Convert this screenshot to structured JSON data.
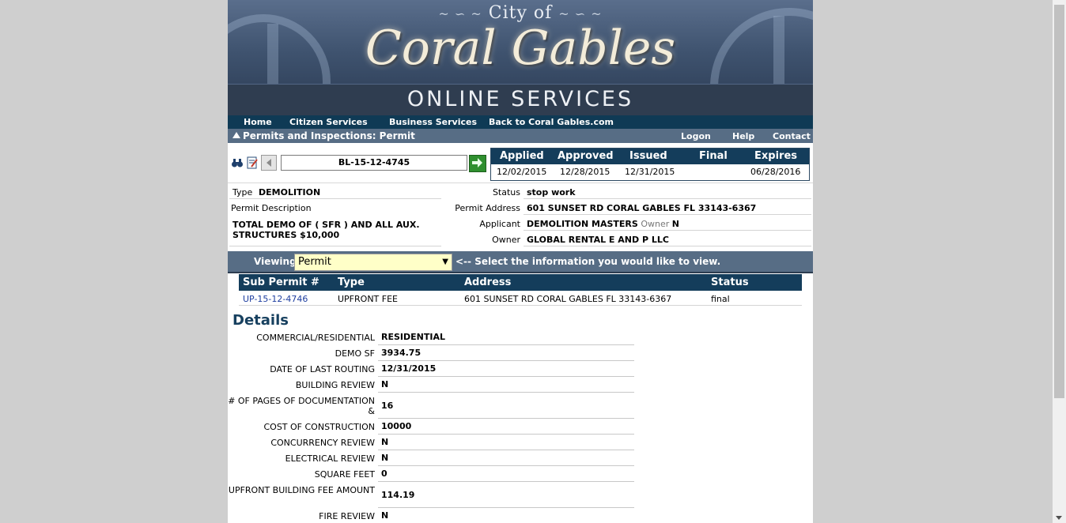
{
  "banner": {
    "city_of": "City of",
    "name": "Coral Gables",
    "subtitle": "ONLINE SERVICES"
  },
  "nav": {
    "items": [
      "Home",
      "Citizen Services",
      "Business Services",
      "Back to Coral Gables.com"
    ]
  },
  "breadcrumb": {
    "title": "Permits and Inspections: Permit",
    "logon": "Logon",
    "help": "Help",
    "contact": "Contact"
  },
  "search": {
    "permit_number": "BL-15-12-4745"
  },
  "dates": {
    "headers": [
      "Applied",
      "Approved",
      "Issued",
      "Final",
      "Expires"
    ],
    "values": [
      "12/02/2015",
      "12/28/2015",
      "12/31/2015",
      "",
      "06/28/2016"
    ]
  },
  "info": {
    "type_label": "Type",
    "type_value": "DEMOLITION",
    "desc_label": "Permit Description",
    "desc_value": "TOTAL DEMO OF ( SFR ) AND ALL AUX. STRUCTURES $10,000",
    "status_label": "Status",
    "status_value": "stop work",
    "address_label": "Permit Address",
    "address_value": "601 SUNSET RD CORAL GABLES FL 33143-6367",
    "applicant_label": "Applicant",
    "applicant_value": "DEMOLITION MASTERS",
    "applicant_owner_label": "Owner",
    "applicant_owner_value": "N",
    "owner_label": "Owner",
    "owner_value": "GLOBAL RENTAL E AND P LLC"
  },
  "viewing": {
    "label": "Viewing",
    "selected": "Permit",
    "hint": "<-- Select the information you would like to view."
  },
  "sub_permits": {
    "headers": [
      "Sub Permit #",
      "Type",
      "Address",
      "Status"
    ],
    "rows": [
      {
        "number": "UP-15-12-4746",
        "type": "UPFRONT FEE",
        "address": "601 SUNSET RD CORAL GABLES FL 33143-6367",
        "status": "final"
      }
    ]
  },
  "details": {
    "title": "Details",
    "rows": [
      {
        "label": "COMMERCIAL/RESIDENTIAL",
        "value": "RESIDENTIAL"
      },
      {
        "label": "DEMO SF",
        "value": "3934.75"
      },
      {
        "label": "DATE OF LAST ROUTING",
        "value": "12/31/2015"
      },
      {
        "label": "BUILDING REVIEW",
        "value": "N"
      },
      {
        "label": "# OF PAGES OF DOCUMENTATION &",
        "value": "16"
      },
      {
        "label": "COST OF CONSTRUCTION",
        "value": "10000"
      },
      {
        "label": "CONCURRENCY REVIEW",
        "value": "N"
      },
      {
        "label": "ELECTRICAL REVIEW",
        "value": "N"
      },
      {
        "label": "SQUARE FEET",
        "value": "0"
      },
      {
        "label": "UPFRONT BUILDING FEE AMOUNT",
        "value": "114.19"
      },
      {
        "label": "FIRE REVIEW",
        "value": "N"
      }
    ]
  }
}
